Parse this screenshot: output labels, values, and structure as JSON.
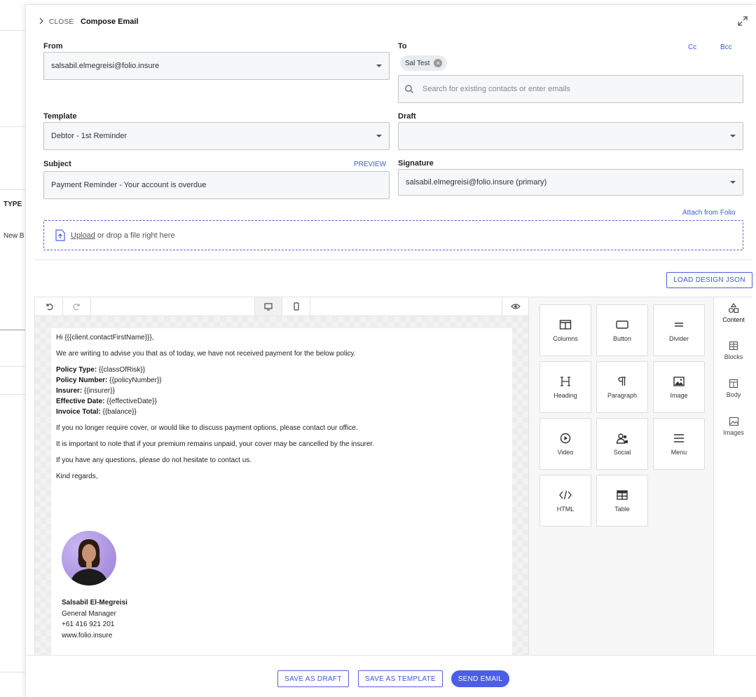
{
  "background": {
    "type_header": "TYPE",
    "row_text": "New B"
  },
  "header": {
    "close_label": "CLOSE",
    "title": "Compose Email"
  },
  "form": {
    "from_label": "From",
    "from_value": "salsabil.elmegreisi@folio.insure",
    "to_label": "To",
    "cc_label": "Cc",
    "bcc_label": "Bcc",
    "to_chip": "Sal Test",
    "to_search_placeholder": "Search for existing contacts or enter emails",
    "template_label": "Template",
    "template_value": "Debtor - 1st Reminder",
    "draft_label": "Draft",
    "draft_value": "",
    "subject_label": "Subject",
    "preview_label": "PREVIEW",
    "subject_value": "Payment Reminder - Your account is overdue",
    "signature_label": "Signature",
    "signature_value": "salsabil.elmegreisi@folio.insure (primary)",
    "attach_label": "Attach from Folio",
    "upload_link": "Upload",
    "upload_text": "or drop a file right here"
  },
  "load_design_label": "LOAD DESIGN JSON",
  "email": {
    "greeting": "Hi {{{client.contactFirstName}}},",
    "intro": "We are writing to advise you that as of today, we have not received payment for the below policy.",
    "policy_lines": [
      {
        "label": "Policy Type:",
        "value": "{{classOfRisk}}"
      },
      {
        "label": "Policy Number:",
        "value": "{{policyNumber}}"
      },
      {
        "label": "Insurer:",
        "value": "{{insurer}}"
      },
      {
        "label": "Effective Date:",
        "value": "{{effectiveDate}}"
      },
      {
        "label": "Invoice Total:",
        "value": "{{balance}}"
      }
    ],
    "para1": "If you no longer require cover, or would like to discuss payment options, please contact our office.",
    "para2": "It is important to note that if your premium remains unpaid, your cover may be cancelled by the insurer.",
    "para3": "If you have any questions, please do not hesitate to contact us.",
    "closing": "Kind regards,",
    "sig_name": "Salsabil El-Megreisi",
    "sig_title": "General Manager",
    "sig_phone": "+61 416 921 201",
    "sig_web": "www.folio.insure"
  },
  "tools": [
    "Columns",
    "Button",
    "Divider",
    "Heading",
    "Paragraph",
    "Image",
    "Video",
    "Social",
    "Menu",
    "HTML",
    "Table"
  ],
  "side_tabs": [
    "Content",
    "Blocks",
    "Body",
    "Images"
  ],
  "footer": {
    "save_draft": "SAVE AS DRAFT",
    "save_template": "SAVE AS TEMPLATE",
    "send": "SEND EMAIL"
  },
  "colors": {
    "accent": "#4c5ee8",
    "link": "#3b5bdb"
  }
}
